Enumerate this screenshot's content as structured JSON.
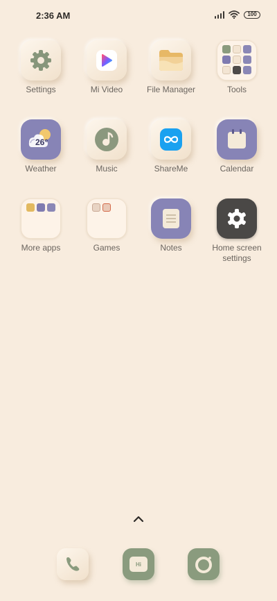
{
  "status_bar": {
    "time": "2:36 AM",
    "battery_level": "100",
    "signal_icon": "cellular-signal-icon",
    "wifi_icon": "wifi-icon"
  },
  "apps": {
    "settings": "Settings",
    "mi_video": "Mi Video",
    "file_manager": "File Manager",
    "tools": "Tools",
    "weather": "Weather",
    "weather_temp": "26°",
    "music": "Music",
    "shareme": "ShareMe",
    "calendar": "Calendar",
    "more_apps": "More apps",
    "games": "Games",
    "notes": "Notes",
    "home_screen_settings": "Home screen settings"
  },
  "dock": {
    "phone_icon": "phone-icon",
    "messaging_icon": "messaging-icon",
    "messaging_text": "Hi",
    "camera_icon": "camera-icon"
  },
  "colors": {
    "background": "#f8ecde",
    "accent_green": "#8a9b7e",
    "accent_purple": "#8a87b6",
    "accent_blue": "#1aa1f0"
  }
}
